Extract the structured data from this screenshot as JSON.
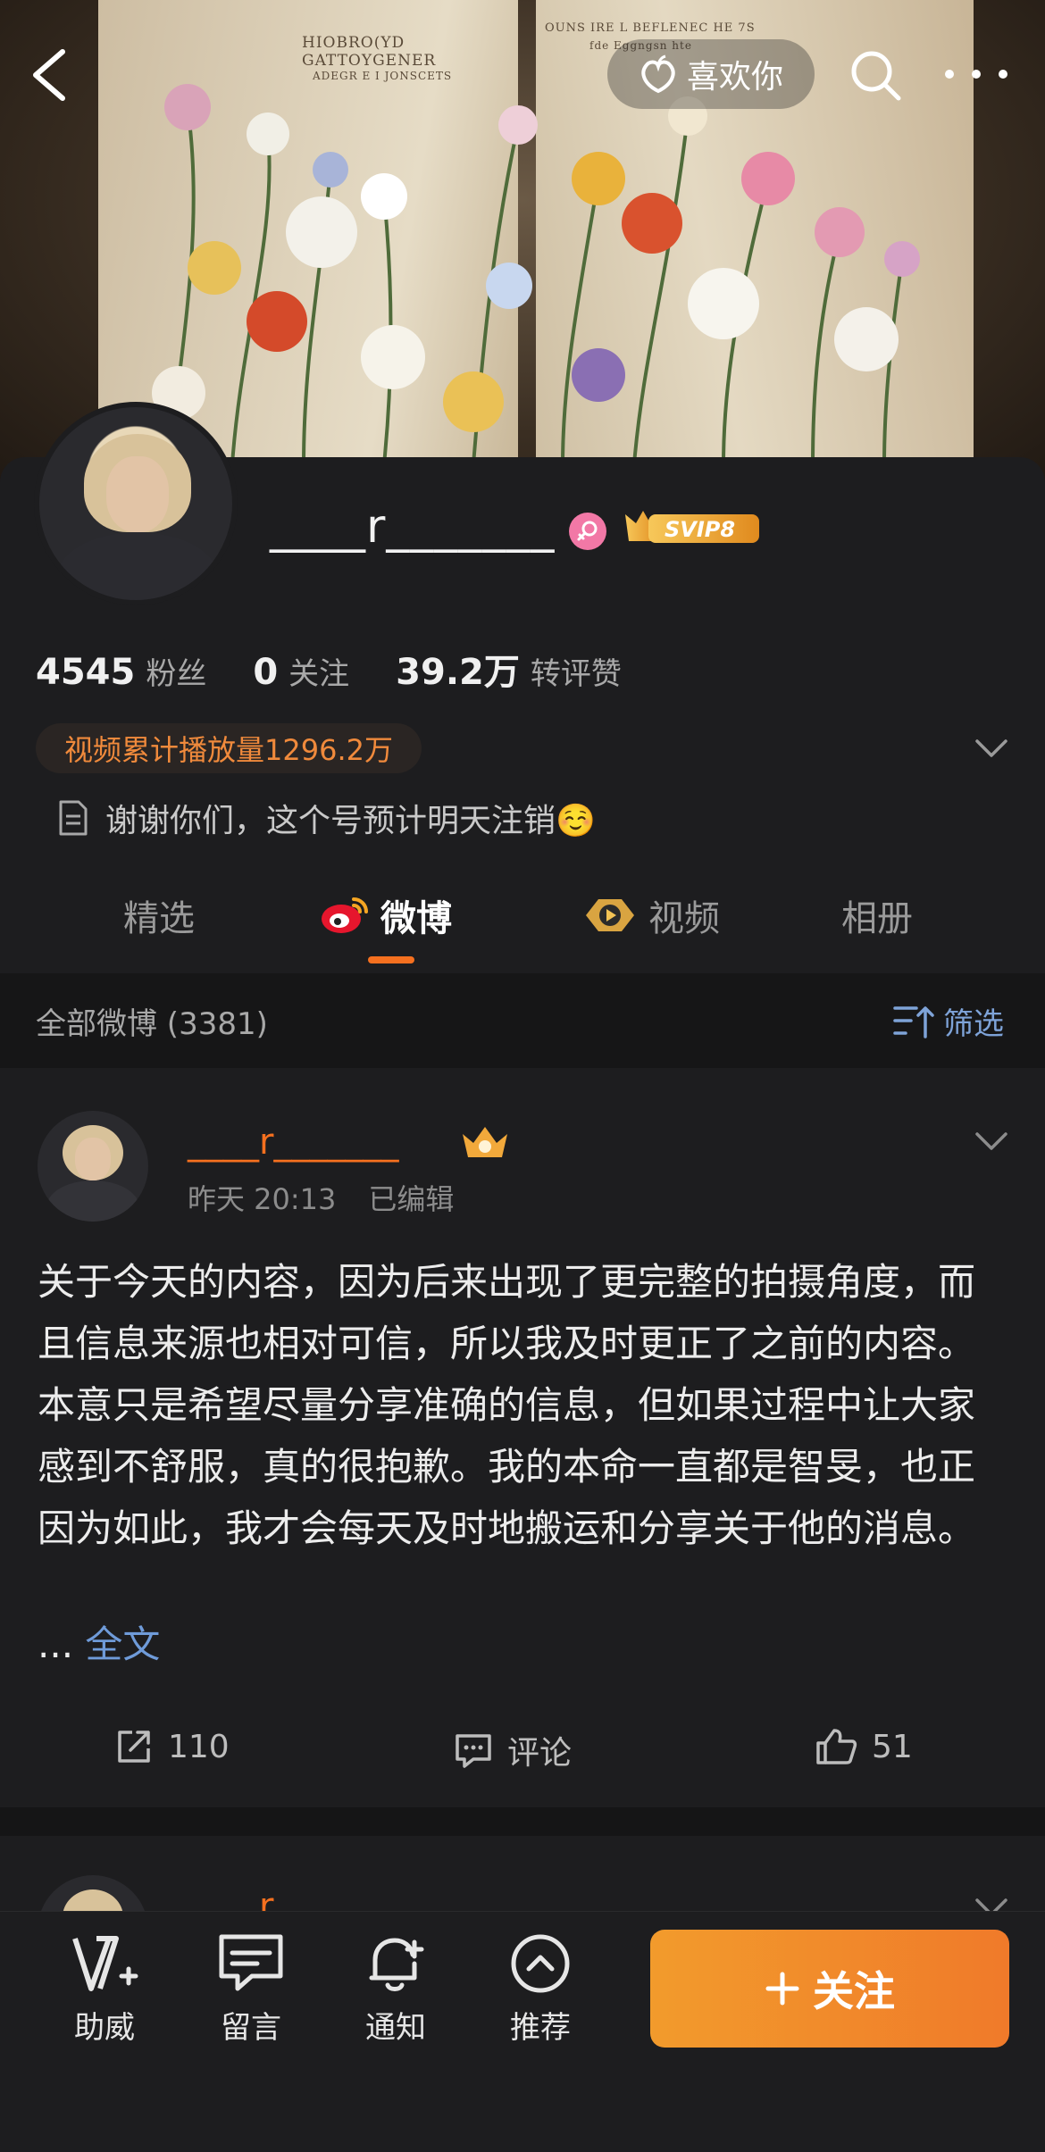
{
  "header": {
    "like_label": "喜欢你"
  },
  "cover": {
    "book_text_left_1": "HIOBRO(YD",
    "book_text_left_2": "GATTOYGENER",
    "book_text_left_3": "ADEGR E I JONSCETS",
    "book_text_right_1": "OUNS IRE L BEFLENEC HE 7S",
    "book_text_right_2": "fde   Eggngsn hte"
  },
  "profile": {
    "username": "____r_______",
    "badge": "SVIP8",
    "stats": [
      {
        "num": "4545",
        "label": "粉丝"
      },
      {
        "num": "0",
        "label": "关注"
      },
      {
        "num": "39.2万",
        "label": "转评赞"
      }
    ],
    "play_count": "视频累计播放量1296.2万",
    "bio": "谢谢你们，这个号预计明天注销☺️"
  },
  "tabs": [
    {
      "label": "精选"
    },
    {
      "label": "微博"
    },
    {
      "label": "视频"
    },
    {
      "label": "相册"
    }
  ],
  "feed": {
    "title": "全部微博 (3381)",
    "filter_label": "筛选"
  },
  "post": {
    "author": "____r_______",
    "time": "昨天 20:13",
    "edited": "已编辑",
    "body": "关于今天的内容，因为后来出现了更完整的拍摄角度，而且信息来源也相对可信，所以我及时更正了之前的内容。本意只是希望尽量分享准确的信息，但如果过程中让大家感到不舒服，真的很抱歉。我的本命一直都是智旻，也正因为如此，我才会每天及时地搬运和分享关于他的消息。",
    "ellipsis": "...",
    "full_text": "全文",
    "repost_count": "110",
    "comment_label": "评论",
    "like_count": "51"
  },
  "next_post": {
    "author": "____r"
  },
  "bottom": {
    "items": [
      {
        "label": "助威"
      },
      {
        "label": "留言"
      },
      {
        "label": "通知"
      },
      {
        "label": "推荐"
      }
    ],
    "follow_label": "关注"
  },
  "colors": {
    "accent": "#f5701f",
    "link": "#6f9bd9",
    "background": "#1d1d1f"
  }
}
